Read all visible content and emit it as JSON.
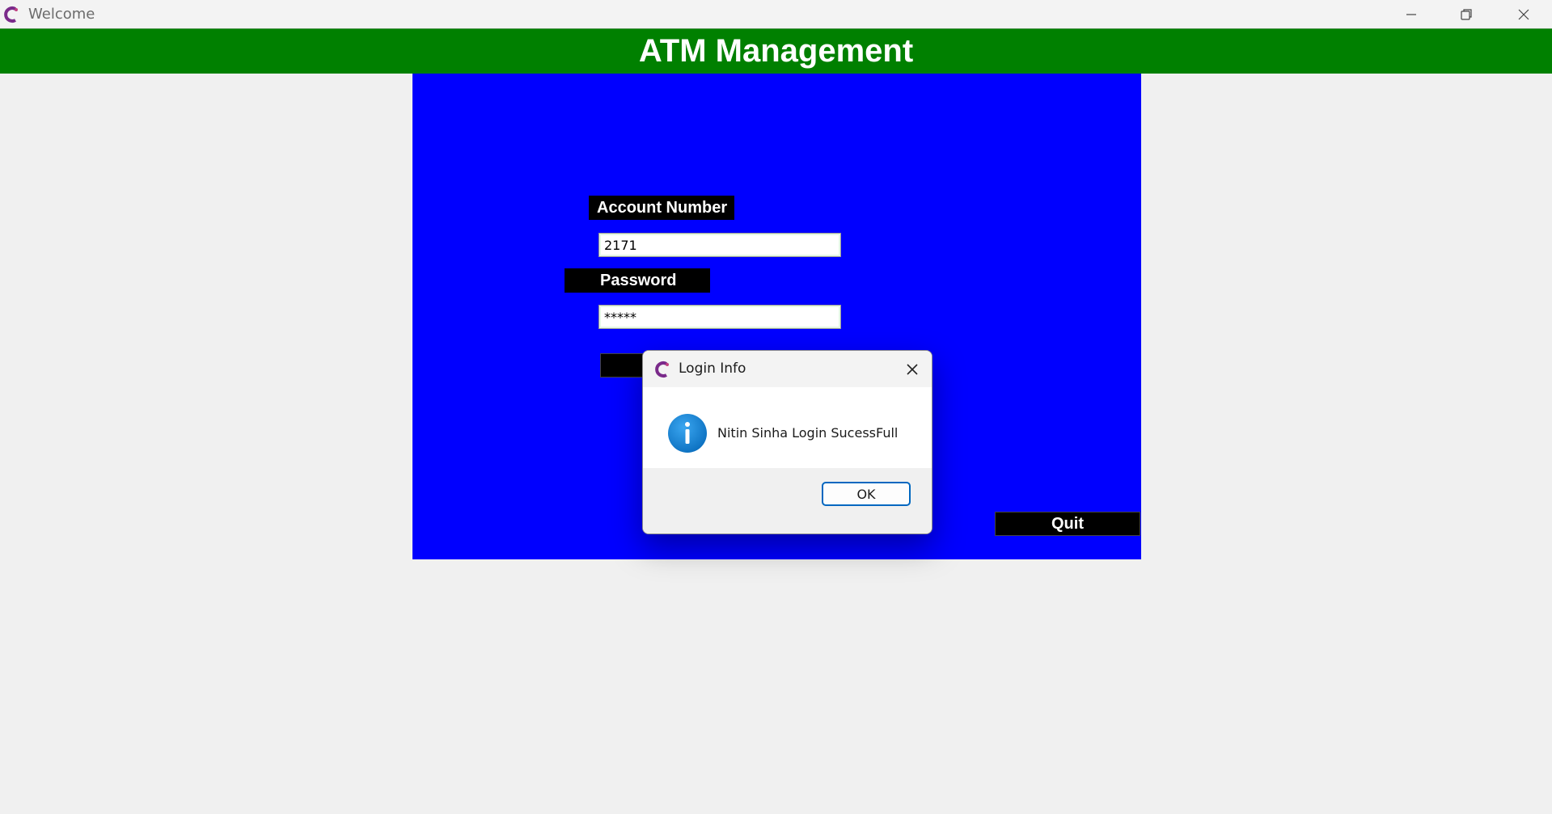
{
  "window": {
    "title": "Welcome"
  },
  "banner": {
    "title": "ATM Management"
  },
  "form": {
    "account_label": "Account Number",
    "account_value": "2171",
    "password_label": "Password",
    "password_value": "*****",
    "quit_label": "Quit"
  },
  "dialog": {
    "title": "Login Info",
    "message": "Nitin Sinha Login SucessFull",
    "ok_label": "OK"
  },
  "colors": {
    "banner": "#008000",
    "panel": "#0000ff",
    "label_bg": "#000000",
    "info_icon": "#1a86d9"
  },
  "icons": {
    "app": "app-logo-icon",
    "minimize": "minimize-icon",
    "restore": "restore-icon",
    "close": "close-icon",
    "info": "info-icon"
  }
}
